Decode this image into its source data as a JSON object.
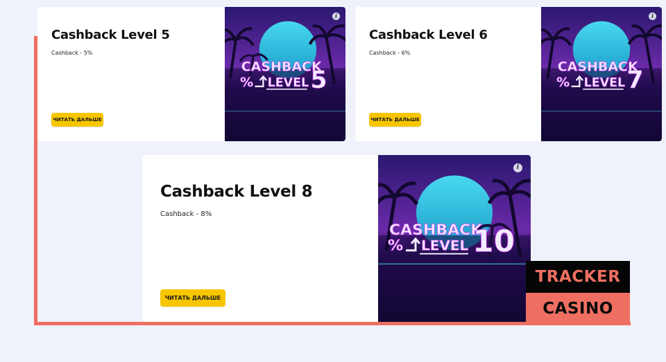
{
  "cards": [
    {
      "title": "Cashback Level 5",
      "description": "Cashback - 5%",
      "button_label": "ЧИТАТЬ ДАЛЬШЕ",
      "banner": {
        "line1": "CASHBACK",
        "line2": "LEVEL",
        "symbol": "%",
        "number": "5"
      },
      "info_icon": "i"
    },
    {
      "title": "Cashback Level 6",
      "description": "Cashback - 6%",
      "button_label": "ЧИТАТЬ ДАЛЬШЕ",
      "banner": {
        "line1": "CASHBACK",
        "line2": "LEVEL",
        "symbol": "%",
        "number": "7"
      },
      "info_icon": "i"
    },
    {
      "title": "Cashback Level 8",
      "description": "Cashback - 8%",
      "button_label": "ЧИТАТЬ ДАЛЬШЕ",
      "banner": {
        "line1": "CASHBACK",
        "line2": "LEVEL",
        "symbol": "%",
        "number": "10"
      },
      "info_icon": "i"
    }
  ],
  "watermark": {
    "line1": "TRACKER",
    "line2": "CASINO"
  },
  "colors": {
    "background": "#eff2fb",
    "accent_frame": "#ee6f61",
    "button": "#f7c600",
    "banner_dark": "#12082e",
    "banner_sun": "#3fd0e6",
    "banner_glow": "#c83cf0"
  },
  "icons": {
    "info": "info-icon",
    "arrow": "arrow-up-icon"
  }
}
